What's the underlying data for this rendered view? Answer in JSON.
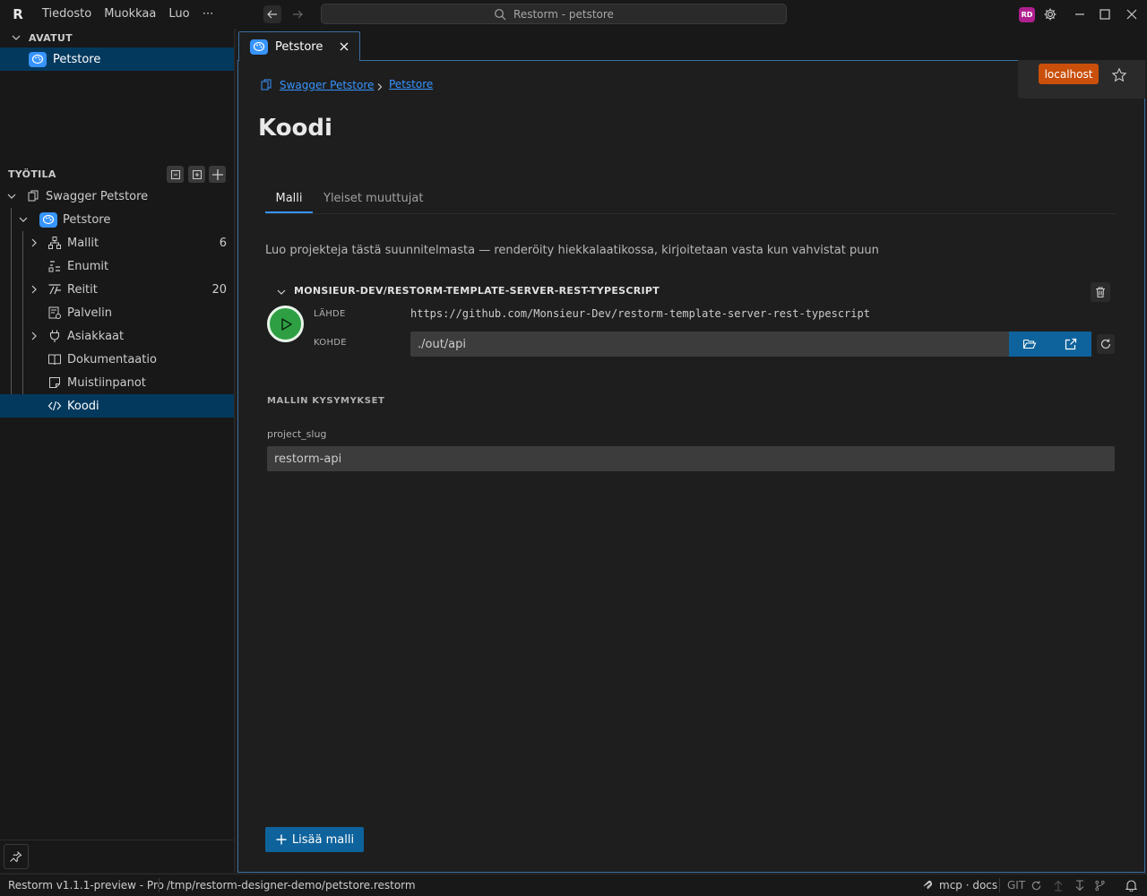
{
  "app": {
    "logo": "R",
    "menu": [
      "Tiedosto",
      "Muokkaa",
      "Luo",
      "⋯"
    ],
    "search_text": "Restorm - petstore",
    "user_initials": "RD",
    "status_color": "#c94f0a",
    "accent": "#3794ff"
  },
  "sidebar": {
    "open_header": "AVATUT",
    "open_item": "Petstore",
    "workspace_header": "TYÖTILA",
    "tree": [
      {
        "label": "Swagger Petstore"
      },
      {
        "label": "Petstore"
      },
      {
        "label": "Mallit",
        "count": "6"
      },
      {
        "label": "Enumit"
      },
      {
        "label": "Reitit",
        "count": "20"
      },
      {
        "label": "Palvelin"
      },
      {
        "label": "Asiakkaat"
      },
      {
        "label": "Dokumentaatio"
      },
      {
        "label": "Muistiinpanot"
      },
      {
        "label": "Koodi"
      }
    ]
  },
  "tab": {
    "label": "Petstore"
  },
  "host": {
    "label": "localhost"
  },
  "breadcrumb": [
    "Swagger Petstore",
    "Petstore"
  ],
  "page": {
    "title": "Koodi",
    "subtabs": [
      "Malli",
      "Yleiset muuttujat"
    ],
    "description": "Luo projekteja tästä suunnitelmasta — renderöity hiekkalaatikossa, kirjoitetaan vasta kun vahvistat puun"
  },
  "template": {
    "name": "MONSIEUR-DEV/RESTORM-TEMPLATE-SERVER-REST-TYPESCRIPT",
    "source_label": "LÄHDE",
    "source_url": "https://github.com/Monsieur-Dev/restorm-template-server-rest-typescript",
    "dest_label": "KOHDE",
    "dest_value": "./out/api"
  },
  "questions": {
    "header": "MALLIN KYSYMYKSET",
    "field_label": "project_slug",
    "field_value": "restorm-api"
  },
  "add_button": "Lisää malli",
  "status": {
    "version": "Restorm v1.1.1-preview - Pro",
    "path": "/tmp/restorm-designer-demo/petstore.restorm",
    "mcp": "mcp · docs",
    "git": "GIT"
  }
}
